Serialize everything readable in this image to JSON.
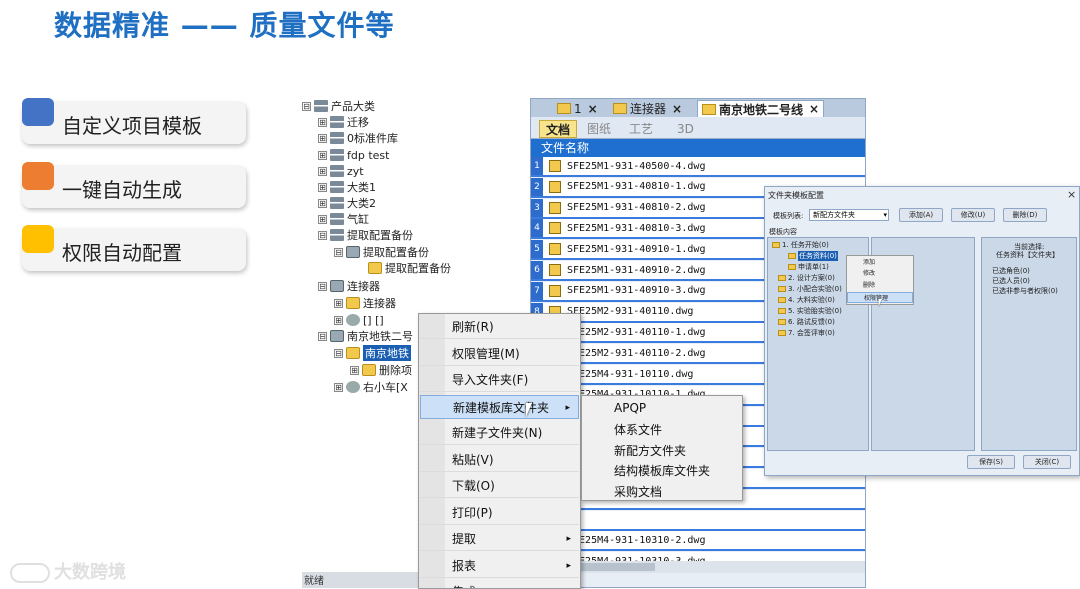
{
  "title": "数据精准 —— 质量文件等",
  "features": [
    {
      "label": "自定义项目模板",
      "color": "#4472c4"
    },
    {
      "label": "一键自动生成",
      "color": "#ed7d31"
    },
    {
      "label": "权限自动配置",
      "color": "#ffc000"
    }
  ],
  "watermark": "大数跨境",
  "tree": {
    "items": [
      {
        "label": "产品大类",
        "toggle": "⊟"
      },
      {
        "label": "迁移",
        "toggle": "⊞"
      },
      {
        "label": "0标准件库",
        "toggle": "⊞"
      },
      {
        "label": "fdp test",
        "toggle": "⊞"
      },
      {
        "label": "zyt",
        "toggle": "⊞"
      },
      {
        "label": "大类1",
        "toggle": "⊞"
      },
      {
        "label": "大类2",
        "toggle": "⊞"
      },
      {
        "label": "气缸",
        "toggle": "⊞"
      },
      {
        "label": "提取配置备份",
        "toggle": "⊟"
      },
      {
        "label": "提取配置备份",
        "toggle": "⊟"
      },
      {
        "label": "提取配置备份",
        "toggle": ""
      },
      {
        "label": "连接器",
        "toggle": "⊟"
      },
      {
        "label": "连接器",
        "toggle": "⊞"
      },
      {
        "label": "[] []",
        "toggle": "⊞"
      },
      {
        "label": "南京地铁二号",
        "toggle": "⊟"
      },
      {
        "label": "南京地铁",
        "toggle": "⊟"
      },
      {
        "label": "删除项",
        "toggle": "⊞"
      },
      {
        "label": "右小车[X",
        "toggle": "⊞"
      }
    ],
    "status": "就绪"
  },
  "filepanel": {
    "tabs": [
      {
        "label": "1",
        "close": "×"
      },
      {
        "label": "连接器",
        "close": "×"
      },
      {
        "label": "南京地铁二号线",
        "close": "×"
      }
    ],
    "subtabs": [
      "文档",
      "图纸",
      "工艺",
      "3D"
    ],
    "column_header": "文件名称",
    "rows": [
      {
        "num": "1",
        "name": "SFE25M1-931-40500-4.dwg"
      },
      {
        "num": "2",
        "name": "SFE25M1-931-40810-1.dwg"
      },
      {
        "num": "3",
        "name": "SFE25M1-931-40810-2.dwg"
      },
      {
        "num": "4",
        "name": "SFE25M1-931-40810-3.dwg"
      },
      {
        "num": "5",
        "name": "SFE25M1-931-40910-1.dwg"
      },
      {
        "num": "6",
        "name": "SFE25M1-931-40910-2.dwg"
      },
      {
        "num": "7",
        "name": "SFE25M1-931-40910-3.dwg"
      },
      {
        "num": "8",
        "name": "SFE25M2-931-40110.dwg"
      },
      {
        "num": "",
        "name": "SFE25M2-931-40110-1.dwg"
      },
      {
        "num": "",
        "name": "SFE25M2-931-40110-2.dwg"
      },
      {
        "num": "",
        "name": "SFE25M4-931-10110.dwg"
      },
      {
        "num": "",
        "name": "SFE25M4-931-10110-1.dwg"
      },
      {
        "num": "",
        "name": ""
      },
      {
        "num": "",
        "name": ""
      },
      {
        "num": "",
        "name": ""
      },
      {
        "num": "",
        "name": ""
      },
      {
        "num": "",
        "name": ""
      },
      {
        "num": "",
        "name": ""
      },
      {
        "num": "",
        "name": "SFE25M4-931-10310-2.dwg"
      },
      {
        "num": "",
        "name": "SFE25M4-931-10310-3.dwg"
      }
    ]
  },
  "context_menu": {
    "items": [
      {
        "label": "刷新(R)",
        "submenu": false
      },
      {
        "label": "权限管理(M)",
        "submenu": false
      },
      {
        "label": "导入文件夹(F)",
        "submenu": false
      },
      {
        "label": "新建模板库文件夹",
        "submenu": true
      },
      {
        "label": "新建子文件夹(N)",
        "submenu": false
      },
      {
        "label": "粘贴(V)",
        "submenu": false
      },
      {
        "label": "下载(O)",
        "submenu": false
      },
      {
        "label": "打印(P)",
        "submenu": false
      },
      {
        "label": "提取",
        "submenu": true
      },
      {
        "label": "报表",
        "submenu": true
      },
      {
        "label": "集成",
        "submenu": true
      }
    ],
    "arrow": "▸"
  },
  "submenu": {
    "items": [
      "APQP",
      "体系文件",
      "新配方文件夹",
      "结构模板库文件夹",
      "采购文档"
    ]
  },
  "dialog": {
    "title": "文件夹模板配置",
    "close": "×",
    "template_list_label": "模板列表:",
    "template_selected": "新配方文件夹",
    "add_btn": "添加(A)",
    "edit_btn": "修改(U)",
    "delete_btn": "删除(D)",
    "content_label": "模板内容",
    "nodes": [
      "1. 任务开始(0)",
      "任务资料(0)",
      "申请单(1)",
      "2. 设计方案(0)",
      "3. 小配合实验(0)",
      "4. 大料实验(0)",
      "5. 实验胎实验(0)",
      "6. 路试反馈(0)",
      "7. 会签评审(0)"
    ],
    "current_label": "当前选择:",
    "current_value": "任务资料【文件夹】",
    "perm_items": [
      "已选角色(0)",
      "已选人员(0)",
      "已选非参与者权限(0)"
    ],
    "save_btn": "保存(S)",
    "close_btn": "关闭(C)",
    "mini_menu": [
      "添加",
      "修改",
      "删除",
      "权限管理"
    ]
  }
}
